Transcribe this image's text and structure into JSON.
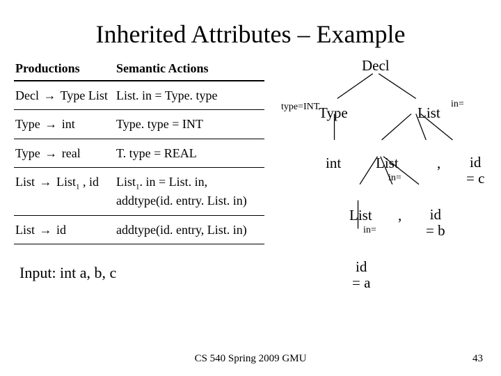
{
  "title": "Inherited Attributes – Example",
  "table": {
    "header": {
      "productions": "Productions",
      "actions": "Semantic Actions"
    },
    "rows": [
      {
        "lhs": "Decl → Type List",
        "rhs": "List. in = Type. type"
      },
      {
        "lhs": "Type → int",
        "rhs": "Type. type = INT"
      },
      {
        "lhs": "Type → real",
        "rhs": "T. type = REAL"
      },
      {
        "lhs": "List → List₁ , id",
        "rhs": "List₁. in = List. in,\naddtype(id. entry. List. in)"
      },
      {
        "lhs": "List → id",
        "rhs": "addtype(id. entry, List. in)"
      }
    ]
  },
  "input_label": "Input: int a, b, c",
  "tree": {
    "decl": "Decl",
    "type": "Type",
    "list0": "List",
    "int": "int",
    "list1": "List",
    "comma1": ",",
    "idc": "id\n= c",
    "list2": "List",
    "comma2": ",",
    "idb": "id\n= b",
    "ida": "id\n= a",
    "attr_type": "type=INT",
    "attr_in0": "in=",
    "attr_in1": "in=",
    "attr_in2": "in="
  },
  "footer": {
    "center": "CS 540 Spring 2009 GMU",
    "page": "43"
  }
}
